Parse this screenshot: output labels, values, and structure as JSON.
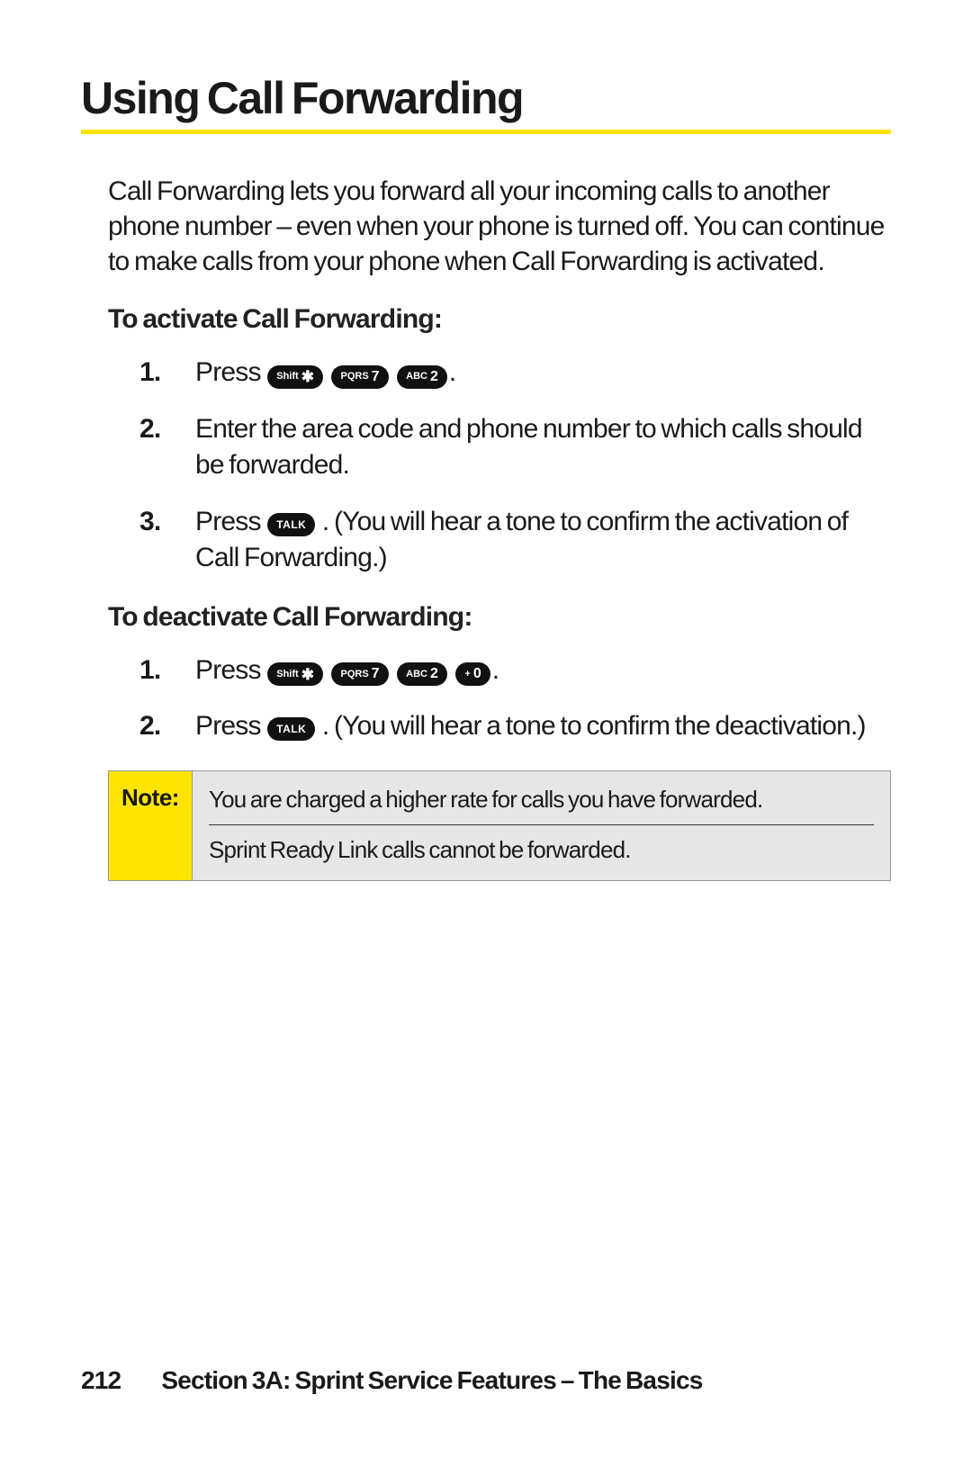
{
  "title": "Using Call Forwarding",
  "intro": "Call Forwarding lets you forward all your incoming calls to another phone number – even when your phone is turned off. You can continue to make calls from your phone when Call Forwarding is activated.",
  "activate": {
    "heading": "To activate Call Forwarding:",
    "steps": {
      "s1_press": "Press",
      "s1_period": ".",
      "s2": "Enter the area code and phone number to which calls should be forwarded.",
      "s3_press": "Press",
      "s3_rest": ". (You will hear a tone to confirm the activation of Call Forwarding.)"
    }
  },
  "deactivate": {
    "heading": "To deactivate Call Forwarding:",
    "steps": {
      "s1_press": "Press",
      "s1_period": ".",
      "s2_press": "Press",
      "s2_rest": ". (You will hear a tone to confirm the deactivation.)"
    }
  },
  "keys": {
    "shift_sub": "Shift",
    "shift_main": "✱",
    "k7_sub": "PQRS",
    "k7_main": "7",
    "k2_sub": "ABC",
    "k2_main": "2",
    "k0_sub": "+",
    "k0_main": "0",
    "talk": "TALK"
  },
  "note": {
    "label": "Note:",
    "line1": "You are charged a higher rate for calls you have forwarded.",
    "line2": "Sprint Ready Link calls cannot be forwarded."
  },
  "footer": {
    "page": "212",
    "section": "Section 3A: Sprint Service Features – The Basics"
  }
}
